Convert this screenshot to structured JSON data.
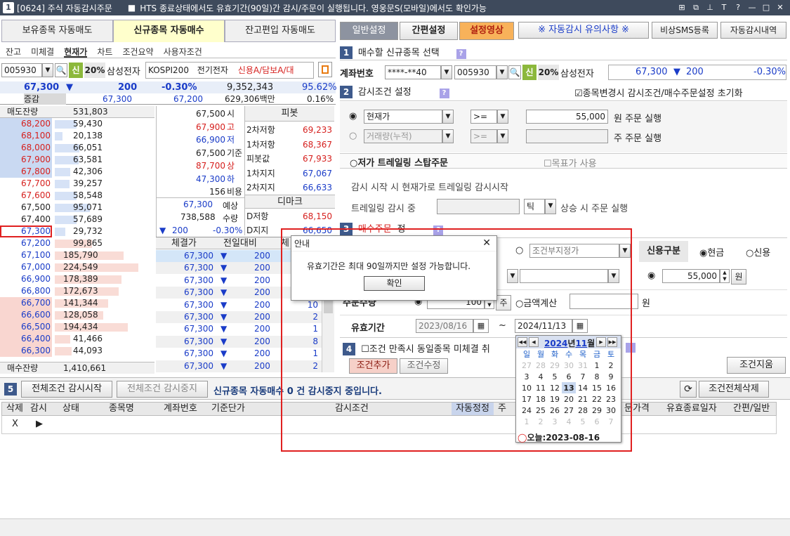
{
  "titlebar": {
    "num": "1",
    "title": "[0624] 주식 자동감시주문",
    "notice_icon": "■",
    "notice": "HTS 종료상태에서도 유효기간(90일)간 감시/주문이 실행됩니다. 영웅문S(모바일)에서도 확인가능",
    "icons": [
      "⊞",
      "⧉",
      "⊥",
      "T",
      "?",
      "—",
      "□",
      "✕"
    ]
  },
  "main_tabs": [
    "보유종목 자동매도",
    "신규종목 자동매수",
    "잔고편입 자동매도"
  ],
  "top_buttons": {
    "general": "일반설정",
    "simple": "간편설정",
    "video": "설정영상",
    "caution": "※ 자동감시 유의사항 ※",
    "sms": "비상SMS등록",
    "history": "자동감시내역"
  },
  "sub_tabs": [
    "잔고",
    "미체결",
    "현재가",
    "차트",
    "조건요약",
    "사용자조건"
  ],
  "left": {
    "code": "005930",
    "shin": "신",
    "pct": "20%",
    "name": "삼성전자",
    "market": "KOSPI200",
    "name2": "전기전자",
    "credit": "신용A/담보A/대",
    "price": "67,300",
    "arrow": "▼",
    "change": "200",
    "rate": "-0.30%",
    "volume": "9,352,343",
    "power": "95.62%",
    "inc_label": "증감",
    "inc1": "67,300",
    "inc2": "67,200",
    "amount": "629,306백만",
    "rate2": "0.16%"
  },
  "orderbook": {
    "sell_header": "매도잔량",
    "sell_total": "531,803",
    "asks": [
      [
        "68,200",
        "59,430",
        0.22
      ],
      [
        "68,100",
        "20,138",
        0.08
      ],
      [
        "68,000",
        "66,051",
        0.25
      ],
      [
        "67,900",
        "63,581",
        0.24
      ],
      [
        "67,800",
        "42,306",
        0.16
      ],
      [
        "67,700",
        "39,257",
        0.15
      ],
      [
        "67,600",
        "58,548",
        0.22
      ],
      [
        "67,500",
        "95,071",
        0.36
      ],
      [
        "67,400",
        "57,689",
        0.22
      ],
      [
        "67,300",
        "29,732",
        0.11
      ]
    ],
    "bids": [
      [
        "67,200",
        "99,865",
        0.38
      ],
      [
        "67,100",
        "185,790",
        0.7
      ],
      [
        "67,000",
        "224,549",
        0.85
      ],
      [
        "66,900",
        "178,389",
        0.68
      ],
      [
        "66,800",
        "172,673",
        0.65
      ],
      [
        "66,700",
        "141,344",
        0.54
      ],
      [
        "66,600",
        "128,058",
        0.49
      ],
      [
        "66,500",
        "194,434",
        0.74
      ],
      [
        "66,400",
        "41,466",
        0.16
      ],
      [
        "66,300",
        "44,093",
        0.17
      ]
    ],
    "buy_label": "매수잔량",
    "buy_total": "1,410,661"
  },
  "midinfo": [
    [
      "67,500",
      "시"
    ],
    [
      "67,900",
      "고"
    ],
    [
      "66,900",
      "저"
    ],
    [
      "67,500",
      "기준"
    ],
    [
      "87,700",
      "상"
    ],
    [
      "47,300",
      "하"
    ],
    [
      "156",
      "비용"
    ]
  ],
  "expect": {
    "price": "67,300",
    "label": "예상",
    "qty": "738,588",
    "qty_label": "수량",
    "arrow": "▼",
    "chg": "200",
    "rate": "-0.30%"
  },
  "pivot": {
    "title": "피봇",
    "rows": [
      [
        "2차저항",
        "69,233"
      ],
      [
        "1차저항",
        "68,367"
      ],
      [
        "피봇값",
        "67,933"
      ],
      [
        "1차지지",
        "67,067"
      ],
      [
        "2차지지",
        "66,633"
      ]
    ],
    "dmark": "디마크",
    "d1": [
      "D저항",
      "68,150"
    ],
    "d2": [
      "D지지",
      "66,650"
    ]
  },
  "trades": {
    "headers": [
      "체결가",
      "전일대비",
      "체"
    ],
    "rows": [
      [
        "67,300",
        "▼",
        "200",
        ""
      ],
      [
        "67,300",
        "▼",
        "200",
        ""
      ],
      [
        "67,300",
        "▼",
        "200",
        ""
      ],
      [
        "67,300",
        "▼",
        "200",
        ""
      ],
      [
        "67,300",
        "▼",
        "200",
        "10"
      ],
      [
        "67,300",
        "▼",
        "200",
        "2"
      ],
      [
        "67,300",
        "▼",
        "200",
        "1"
      ],
      [
        "67,300",
        "▼",
        "200",
        "8"
      ],
      [
        "67,300",
        "▼",
        "200",
        "1"
      ],
      [
        "67,300",
        "▼",
        "200",
        "2"
      ]
    ]
  },
  "sec1": {
    "num": "1",
    "title": "매수할 신규종목 선택",
    "q": "?",
    "acct_label": "계좌번호",
    "acct": "****-**40",
    "code": "005930",
    "shin": "신",
    "pct": "20%",
    "name": "삼성전자",
    "price": "67,300",
    "arrow": "▼",
    "chg": "200",
    "rate": "-0.30%"
  },
  "sec2": {
    "num": "2",
    "title": "감시조건 설정",
    "q": "?",
    "reset": "종목변경시 감시조건/매수주문설정 초기화",
    "cond1": "현재가",
    "op1": ">=",
    "val1": "55,000",
    "unit1": "원 주문 실행",
    "cond2": "거래량(누적)",
    "op2": ">=",
    "unit2": "주 주문 실행",
    "trail_title": "○저가 트레일링 스탑주문",
    "target": "목표가 사용",
    "trail_desc": "감시 시작 시 현재가로 트레일링 감시시작",
    "trail_label": "트레일링 감시 중",
    "tick": "틱",
    "trail_unit": "상승 시 주문 실행"
  },
  "sec3": {
    "num": "3",
    "title": "매수주문",
    "suffix": "정",
    "q": "?",
    "cond_price": "조건부지정가",
    "credit_label": "신용구분",
    "cash": "현금",
    "credit": "신용",
    "price": "55,000",
    "won": "원",
    "qty_label": "주문수량",
    "qty": "100",
    "ju": "주",
    "amt_calc": "금액계산",
    "won2": "원",
    "valid_label": "유효기간",
    "start": "2023/08/16",
    "tilde": "~",
    "end": "2024/11/13"
  },
  "sec4": {
    "num": "4",
    "text": "조건 만족시 동일종목 미체결 취",
    "add": "조건추가",
    "edit": "조건수정",
    "del": "조건지움"
  },
  "sec5": {
    "num": "5",
    "all_watch": "전체조건 감시시작",
    "stop": "전체조건 감시중지",
    "status": "신규종목 자동매수 0 건 감시중지 중입니다.",
    "refresh": "⟳",
    "del_all": "조건전체삭제"
  },
  "table": {
    "headers": [
      "삭제",
      "감시",
      "상태",
      "종목명",
      "계좌번호",
      "기준단가",
      "감시조건",
      "자동정정",
      "주",
      "문가격",
      "유효종료일자",
      "간편/일반"
    ],
    "row": [
      "X",
      "▶"
    ]
  },
  "dialog": {
    "title": "안내",
    "close": "✕",
    "message": "유효기간은 최대 90일까지만 설정 가능합니다.",
    "ok": "확인"
  },
  "calendar": {
    "year": "2024",
    "y_suffix": "년",
    "month": "11",
    "m_suffix": "월",
    "nav": [
      "◀◀",
      "◀",
      "▶",
      "▶▶"
    ],
    "days": [
      "일",
      "월",
      "화",
      "수",
      "목",
      "금",
      "토"
    ],
    "weeks": [
      [
        "27",
        "28",
        "29",
        "30",
        "31",
        "1",
        "2"
      ],
      [
        "3",
        "4",
        "5",
        "6",
        "7",
        "8",
        "9"
      ],
      [
        "10",
        "11",
        "12",
        "13",
        "14",
        "15",
        "16"
      ],
      [
        "17",
        "18",
        "19",
        "20",
        "21",
        "22",
        "23"
      ],
      [
        "24",
        "25",
        "26",
        "27",
        "28",
        "29",
        "30"
      ],
      [
        "1",
        "2",
        "3",
        "4",
        "5",
        "6",
        "7"
      ]
    ],
    "today": "오늘:2023-08-16"
  }
}
